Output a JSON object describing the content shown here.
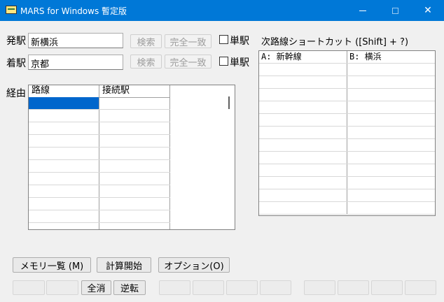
{
  "window": {
    "title": "MARS for Windows 暫定版"
  },
  "departure": {
    "label": "発駅",
    "value": "新横浜",
    "search_label": "検索",
    "exact_label": "完全一致",
    "single_label": "単駅"
  },
  "arrival": {
    "label": "着駅",
    "value": "京都",
    "search_label": "検索",
    "exact_label": "完全一致",
    "single_label": "単駅"
  },
  "route": {
    "label": "経由",
    "columns": [
      "路線",
      "接続駅"
    ]
  },
  "shortcut": {
    "label": "次路線ショートカット ([Shift] + ?)",
    "rows": [
      {
        "a": "A: 新幹線",
        "b": "B: 横浜"
      }
    ]
  },
  "buttons": {
    "memory_list": "メモリ一覧 (M)",
    "calc_start": "計算開始",
    "options": "オプション(O)",
    "clear_all": "全消",
    "reverse": "逆転"
  }
}
